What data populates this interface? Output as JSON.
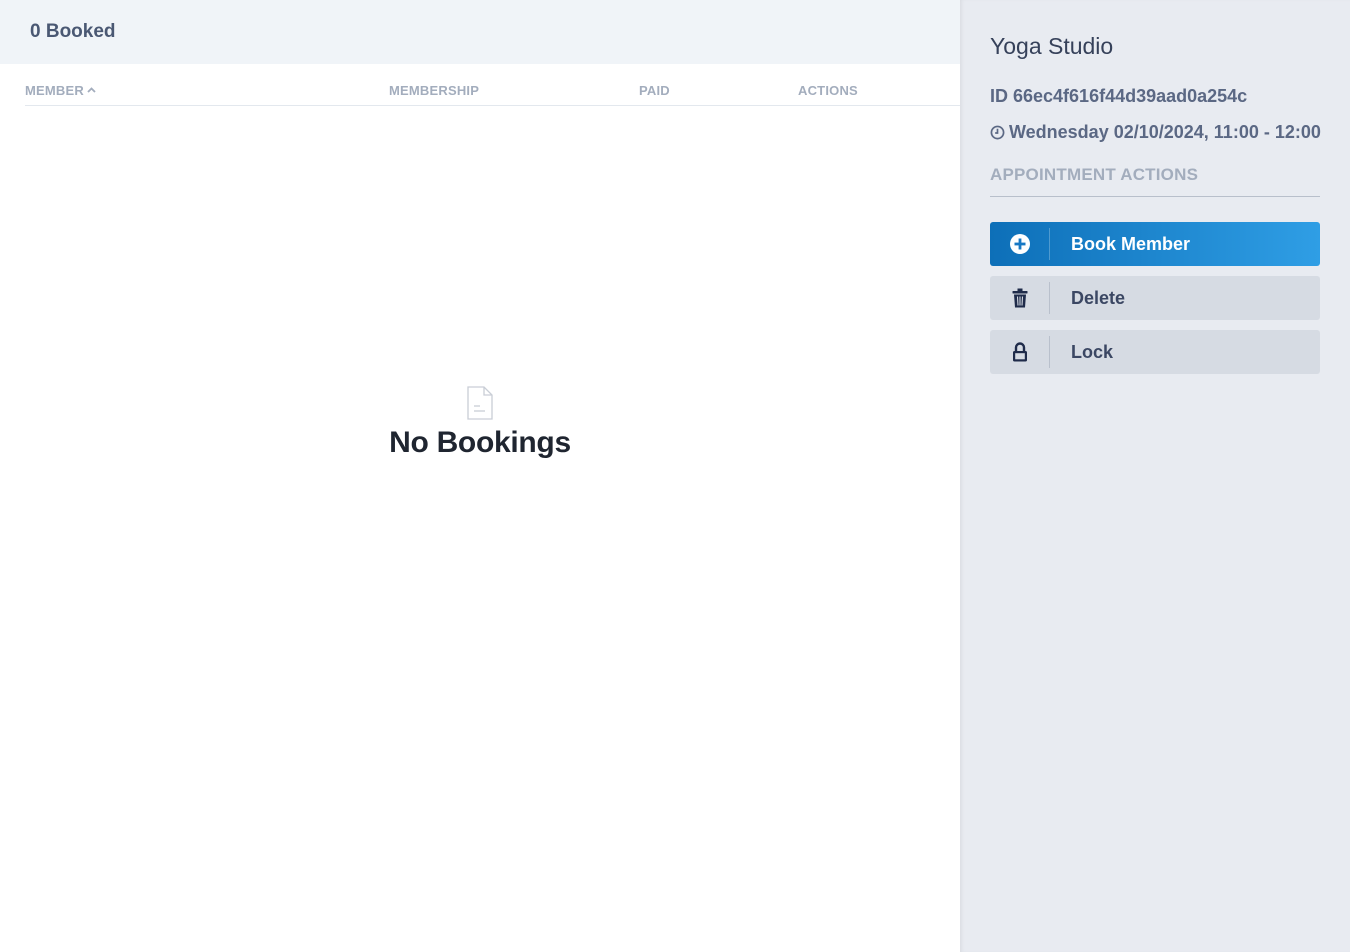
{
  "header": {
    "booked_count": "0 Booked"
  },
  "table": {
    "columns": [
      {
        "label": "MEMBER",
        "sorted": "ascending"
      },
      {
        "label": "MEMBERSHIP"
      },
      {
        "label": "PAID"
      },
      {
        "label": "ACTIONS"
      }
    ]
  },
  "empty_state": {
    "icon": "file-icon",
    "text": "No Bookings"
  },
  "panel": {
    "title": "Yoga Studio",
    "id_text": "ID 66ec4f616f44d39aad0a254c",
    "time_text": "Wednesday 02/10/2024, 11:00 - 12:00",
    "section_title": "APPOINTMENT ACTIONS",
    "actions": [
      {
        "label": "Book Member",
        "icon": "plus-circle-icon",
        "style": "primary"
      },
      {
        "label": "Delete",
        "icon": "trash-icon",
        "style": "secondary"
      },
      {
        "label": "Lock",
        "icon": "lock-icon",
        "style": "secondary"
      }
    ]
  },
  "colors": {
    "primary_start": "#0d6fb8",
    "primary_end": "#2f9ee5",
    "panel_bg": "#e8ebf1",
    "text_dark": "#36415a",
    "text_muted": "#a3adbd"
  }
}
